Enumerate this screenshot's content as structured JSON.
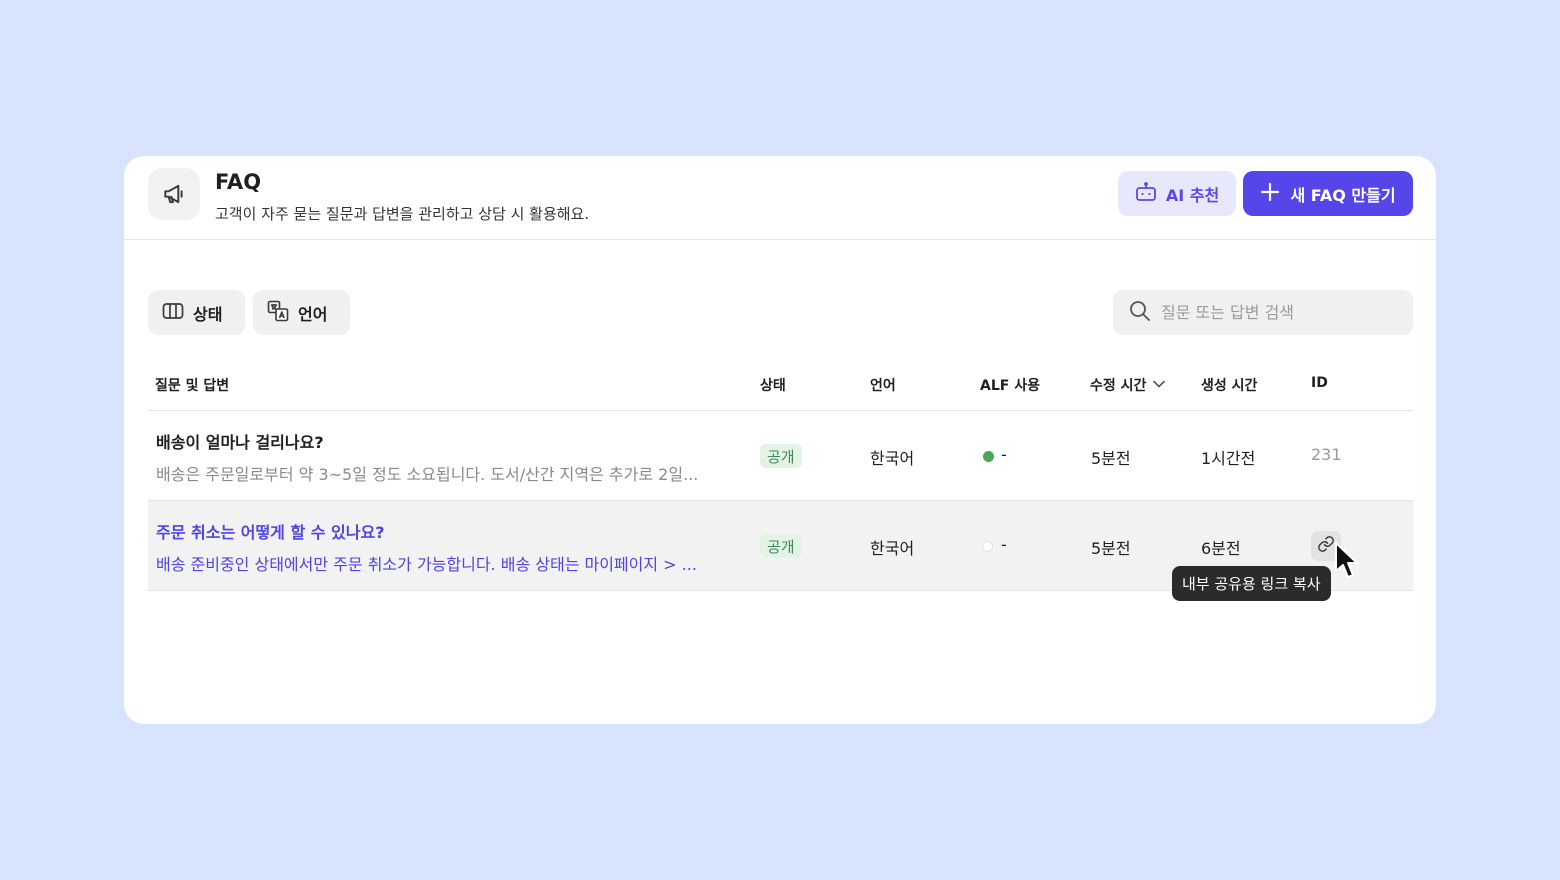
{
  "header": {
    "title": "FAQ",
    "subtitle": "고객이 자주 묻는 질문과 답변을 관리하고 상담 시 활용해요.",
    "icon": "megaphone-icon",
    "ai_button": "AI 추천",
    "new_button": "새 FAQ 만들기"
  },
  "filters": {
    "status": "상태",
    "language": "언어"
  },
  "search": {
    "placeholder": "질문 또는 답변 검색"
  },
  "columns": {
    "qa": "질문 및 답변",
    "status": "상태",
    "language": "언어",
    "alf": "ALF 사용",
    "modified": "수정 시간",
    "created": "생성 시간",
    "id": "ID"
  },
  "rows": [
    {
      "question": "배송이 얼마나 걸리나요?",
      "answer": "배송은 주문일로부터 약 3~5일 정도 소요됩니다. 도서/산간 지역은 추가로 2일...",
      "status": "공개",
      "language": "한국어",
      "alf": "-",
      "alf_enabled": true,
      "modified": "5분전",
      "created": "1시간전",
      "id": "231"
    },
    {
      "question": "주문 취소는 어떻게 할 수 있나요?",
      "answer": "배송 준비중인 상태에서만 주문 취소가 가능합니다. 배송 상태는 마이페이지 > ...",
      "status": "공개",
      "language": "한국어",
      "alf": "-",
      "alf_enabled": false,
      "modified": "5분전",
      "created": "6분전"
    }
  ],
  "tooltip": "내부 공유용 링크 복사",
  "colors": {
    "background": "#d8e4fd",
    "accent": "#5546ea",
    "ai_button_bg": "#e8e8fc",
    "badge_bg": "#e3f3e6",
    "badge_text": "#3c8b52",
    "alf_on": "#4aa653"
  }
}
